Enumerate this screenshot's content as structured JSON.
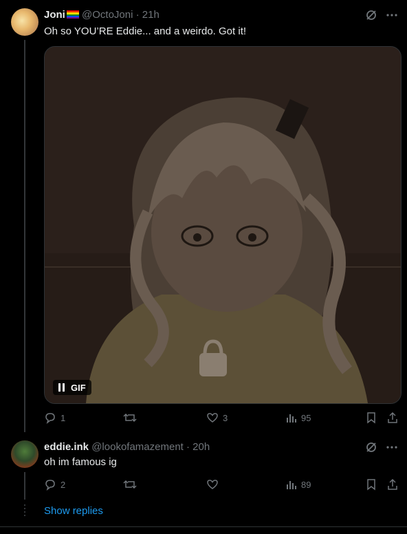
{
  "tweet1": {
    "name": "Joni",
    "handle": "@OctoJoni",
    "time": "21h",
    "text": "Oh so YOU’RE Eddie... and a weirdo. Got it!",
    "media_badge": "GIF",
    "replies": "1",
    "retweets": "",
    "likes": "3",
    "views": "95"
  },
  "tweet2": {
    "name": "eddie.ink",
    "handle": "@lookofamazement",
    "time": "20h",
    "text": "oh im famous ig",
    "replies": "2",
    "retweets": "",
    "likes": "",
    "views": "89"
  },
  "show_replies": "Show replies",
  "colors": {
    "background": "#000000",
    "text": "#e7e9ea",
    "muted": "#71767b",
    "link": "#1d9bf0"
  }
}
